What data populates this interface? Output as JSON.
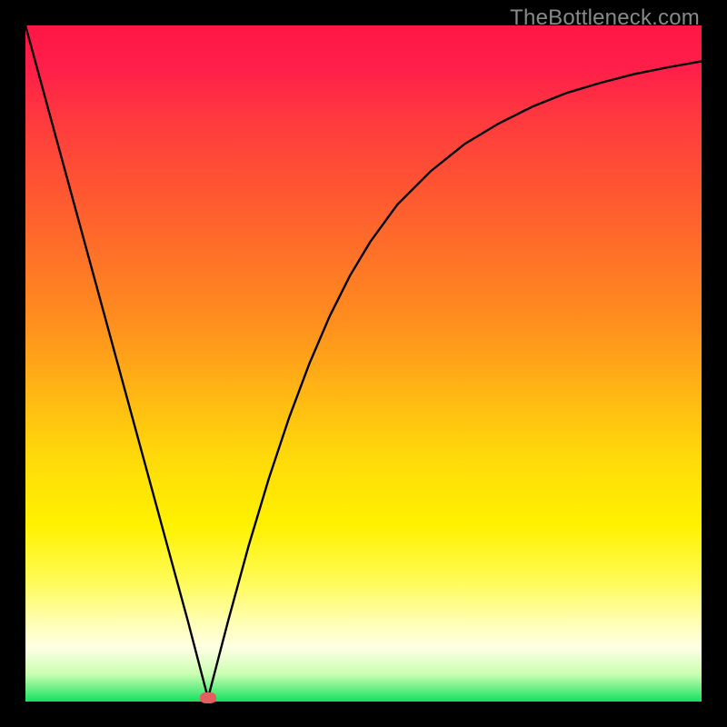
{
  "watermark": "TheBottleneck.com",
  "colors": {
    "page_bg": "#000000",
    "curve": "#000000",
    "marker": "#e06060",
    "gradient_top": "#ff1744",
    "gradient_bottom": "#14e060"
  },
  "chart_data": {
    "type": "line",
    "title": "",
    "xlabel": "",
    "ylabel": "",
    "xlim": [
      0,
      100
    ],
    "ylim": [
      0,
      100
    ],
    "axes_visible": false,
    "grid": false,
    "marker": {
      "x": 27,
      "y": 0.5
    },
    "series": [
      {
        "name": "curve",
        "x": [
          0,
          3,
          6,
          9,
          12,
          15,
          18,
          21,
          24,
          27,
          30,
          33,
          36,
          39,
          42,
          45,
          48,
          51,
          55,
          60,
          65,
          70,
          75,
          80,
          85,
          90,
          95,
          100
        ],
        "values": [
          100,
          89,
          78,
          67,
          56,
          45,
          34,
          23,
          12,
          0.5,
          12,
          23,
          33,
          42,
          50,
          57,
          63,
          68,
          73.5,
          78.5,
          82.5,
          85.5,
          88,
          90,
          91.5,
          92.8,
          93.8,
          94.7
        ]
      }
    ]
  }
}
